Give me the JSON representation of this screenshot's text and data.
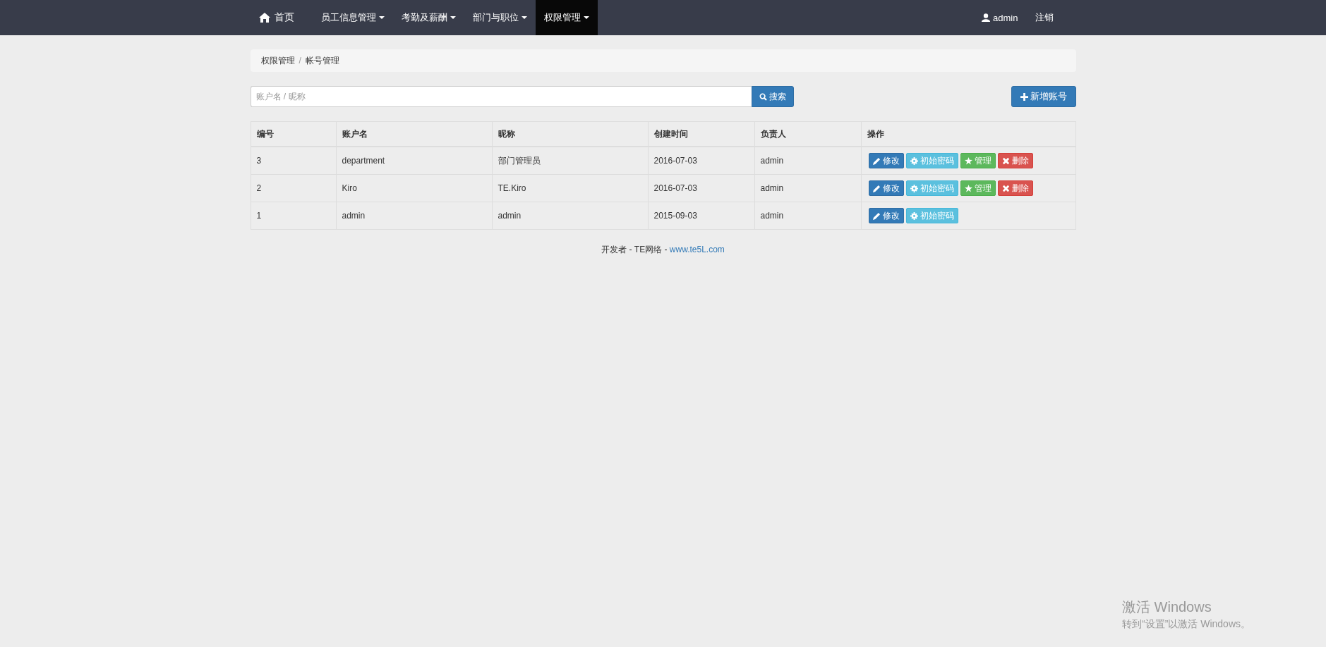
{
  "navbar": {
    "items": [
      {
        "label": "首页",
        "kind": "home",
        "dropdown": false,
        "selected": false
      },
      {
        "label": "员工信息管理",
        "kind": "menu",
        "dropdown": true,
        "selected": false
      },
      {
        "label": "考勤及薪酬",
        "kind": "menu",
        "dropdown": true,
        "selected": false
      },
      {
        "label": "部门与职位",
        "kind": "menu",
        "dropdown": true,
        "selected": false
      },
      {
        "label": "权限管理",
        "kind": "menu",
        "dropdown": true,
        "selected": true
      }
    ],
    "user": "admin",
    "logout": "注销"
  },
  "breadcrumb": [
    "权限管理",
    "帐号管理"
  ],
  "breadcrumb_separator": "/",
  "search": {
    "placeholder": "账户名 / 昵称",
    "button": "搜索"
  },
  "add_button": "新增账号",
  "table": {
    "columns": [
      "编号",
      "账户名",
      "昵称",
      "创建时间",
      "负责人",
      "操作"
    ],
    "rows": [
      {
        "cells": [
          "3",
          "department",
          "部门管理员",
          "2016-07-03",
          "admin"
        ],
        "actions": [
          {
            "kind": "edit",
            "label": "修改"
          },
          {
            "kind": "reset",
            "label": "初始密码"
          },
          {
            "kind": "manage",
            "label": "管理"
          },
          {
            "kind": "delete",
            "label": "删除"
          }
        ]
      },
      {
        "cells": [
          "2",
          "Kiro",
          "TE.Kiro",
          "2016-07-03",
          "admin"
        ],
        "actions": [
          {
            "kind": "edit",
            "label": "修改"
          },
          {
            "kind": "reset",
            "label": "初始密码"
          },
          {
            "kind": "manage",
            "label": "管理"
          },
          {
            "kind": "delete",
            "label": "删除"
          }
        ]
      },
      {
        "cells": [
          "1",
          "admin",
          "admin",
          "2015-09-03",
          "admin"
        ],
        "actions": [
          {
            "kind": "edit",
            "label": "修改"
          },
          {
            "kind": "reset",
            "label": "初始密码"
          }
        ]
      }
    ]
  },
  "footer": {
    "text": "开发者 - TE网络 - ",
    "link": "www.te5L.com"
  },
  "os_notice": {
    "title": "激活 Windows",
    "text": "转到“设置”以激活 Windows。"
  }
}
